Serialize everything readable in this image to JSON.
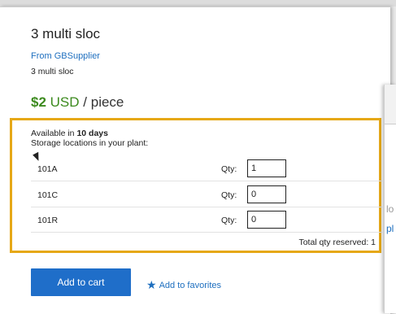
{
  "product": {
    "title": "3 multi sloc",
    "supplier": "From GBSupplier",
    "subtitle": "3 multi sloc"
  },
  "price": {
    "amount": "$2",
    "currency": "USD",
    "unit": "/ piece"
  },
  "availability": {
    "prefix": "Available in",
    "lead_time": "10 days",
    "storage_label": "Storage locations in your plant:",
    "locations": [
      {
        "name": "101A",
        "qty_label": "Qty:",
        "qty": "1"
      },
      {
        "name": "101C",
        "qty_label": "Qty:",
        "qty": "0"
      },
      {
        "name": "101R",
        "qty_label": "Qty:",
        "qty": "0"
      }
    ],
    "total": "Total qty reserved: 1"
  },
  "actions": {
    "add_to_cart": "Add to cart",
    "add_to_favorites": "Add to favorites",
    "favorites_icon": "star-icon"
  },
  "side_window": {
    "fragment_1": "lo",
    "fragment_2": "pl"
  },
  "colors": {
    "accent_blue": "#1f6ec9",
    "link_blue": "#1e6fbf",
    "price_green": "#3c8a1e",
    "highlight_border": "#e6a817"
  }
}
